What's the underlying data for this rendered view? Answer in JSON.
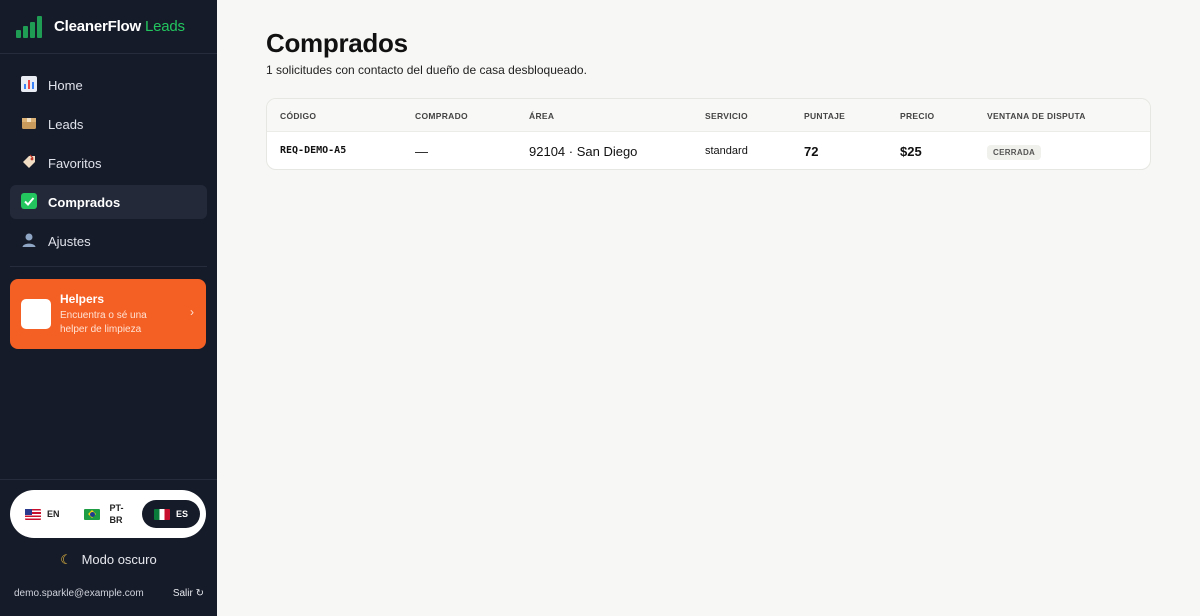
{
  "brand": {
    "name": "CleanerFlow",
    "accent": "Leads"
  },
  "nav": [
    {
      "label": "Home",
      "icon": "chart-icon"
    },
    {
      "label": "Leads",
      "icon": "box-icon"
    },
    {
      "label": "Favoritos",
      "icon": "tag-icon"
    },
    {
      "label": "Comprados",
      "icon": "check-icon",
      "active": true
    },
    {
      "label": "Ajustes",
      "icon": "user-icon"
    }
  ],
  "helpers": {
    "title": "Helpers",
    "subtitle": "Encuentra o sé una helper de limpieza",
    "chevron": "›"
  },
  "languages": [
    {
      "code": "EN",
      "flag": "us-flag-icon"
    },
    {
      "code": "PT-BR",
      "flag": "br-flag-icon"
    },
    {
      "code": "ES",
      "flag": "mx-flag-icon",
      "selected": true
    }
  ],
  "dark_mode": {
    "label": "Modo oscuro"
  },
  "account": {
    "email": "demo.sparkle@example.com",
    "logout": "Salir ↻"
  },
  "page": {
    "title": "Comprados",
    "subtitle": "1 solicitudes con contacto del dueño de casa desbloqueado."
  },
  "table": {
    "columns": [
      "CÓDIGO",
      "COMPRADO",
      "ÁREA",
      "SERVICIO",
      "PUNTAJE",
      "PRECIO",
      "VENTANA DE DISPUTA"
    ],
    "rows": [
      {
        "code": "REQ-DEMO-A5",
        "purchased": "—",
        "area": "92104 · San Diego",
        "service": "standard",
        "score": "72",
        "price": "$25",
        "dispute": "CERRADA"
      }
    ]
  },
  "colors": {
    "sidebar_bg": "#161b29",
    "accent_green": "#22c55e",
    "helpers_orange": "#f45f24",
    "main_bg": "#f7f7f5"
  }
}
